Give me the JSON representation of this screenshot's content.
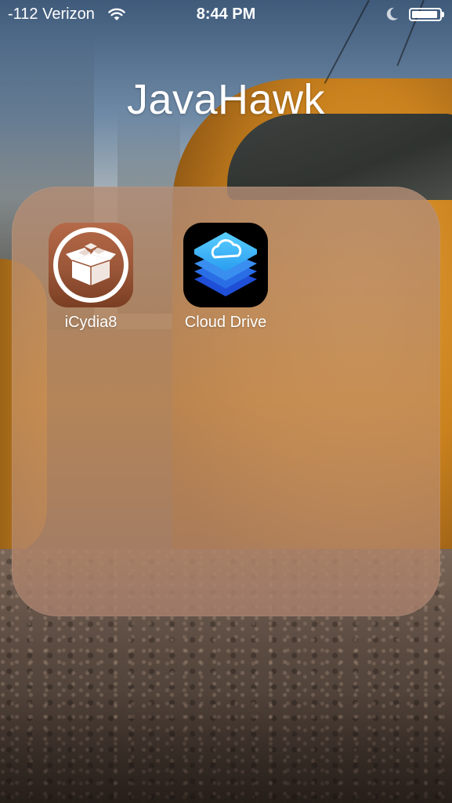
{
  "status_bar": {
    "carrier": "-112 Verizon",
    "time": "8:44 PM",
    "wifi_icon": "wifi-icon",
    "moon_icon": "do-not-disturb-moon-icon",
    "battery_icon": "battery-icon",
    "battery_level": 0.95
  },
  "folder": {
    "title": "JavaHawk",
    "apps": [
      {
        "label": "iCydia8",
        "icon": "cydia-box-icon",
        "color": "#9a5638"
      },
      {
        "label": "Cloud Drive",
        "icon": "cloud-stack-icon",
        "color": "#2e8fe8"
      }
    ]
  }
}
